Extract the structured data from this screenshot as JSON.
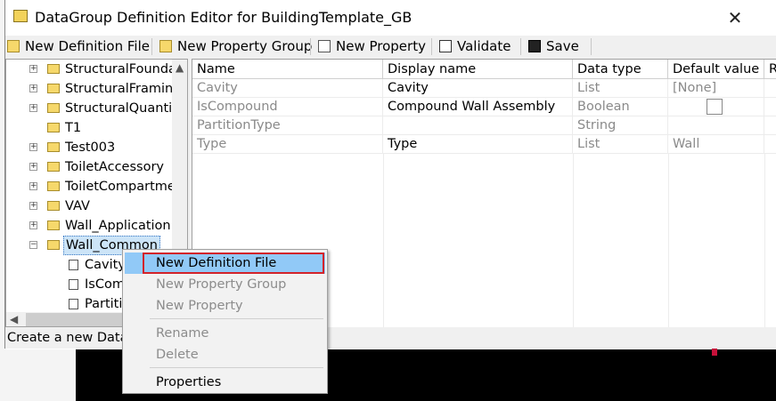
{
  "window": {
    "title": "DataGroup Definition Editor for BuildingTemplate_GB",
    "close_glyph": "✕"
  },
  "toolbar": {
    "new_definition_file": "New Definition File",
    "new_property_group": "New Property Group",
    "new_property": "New Property",
    "validate": "Validate",
    "save": "Save"
  },
  "tree": {
    "items": [
      {
        "label": "StructuralFoundat",
        "expander": "+"
      },
      {
        "label": "StructuralFraming",
        "expander": "+"
      },
      {
        "label": "StructuralQuantiti",
        "expander": "+"
      },
      {
        "label": "T1",
        "expander": ""
      },
      {
        "label": "Test003",
        "expander": "+"
      },
      {
        "label": "ToiletAccessory",
        "expander": "+"
      },
      {
        "label": "ToiletCompartme",
        "expander": "+"
      },
      {
        "label": "VAV",
        "expander": "+"
      },
      {
        "label": "Wall_Application",
        "expander": "+"
      },
      {
        "label": "Wall_Common",
        "expander": "−"
      }
    ],
    "children": [
      "Cavity",
      "IsComp",
      "Partiti"
    ]
  },
  "grid": {
    "columns": [
      "Name",
      "Display name",
      "Data type",
      "Default value",
      "R"
    ],
    "rows": [
      {
        "name": "Cavity",
        "display": "Cavity",
        "type": "List",
        "default": "[None]"
      },
      {
        "name": "IsCompound",
        "display": "Compound Wall Assembly",
        "type": "Boolean",
        "default": ""
      },
      {
        "name": "PartitionType",
        "display": "",
        "type": "String",
        "default": ""
      },
      {
        "name": "Type",
        "display": "Type",
        "type": "List",
        "default": "Wall"
      }
    ]
  },
  "status": {
    "text": "Create a new DataG"
  },
  "context_menu": {
    "items": [
      "New Definition File",
      "New Property Group",
      "New Property",
      "Rename",
      "Delete",
      "Properties"
    ]
  },
  "colors": {
    "highlight": "#91c9f7",
    "outline_red": "#d3232a",
    "folder": "#f6d86b"
  }
}
